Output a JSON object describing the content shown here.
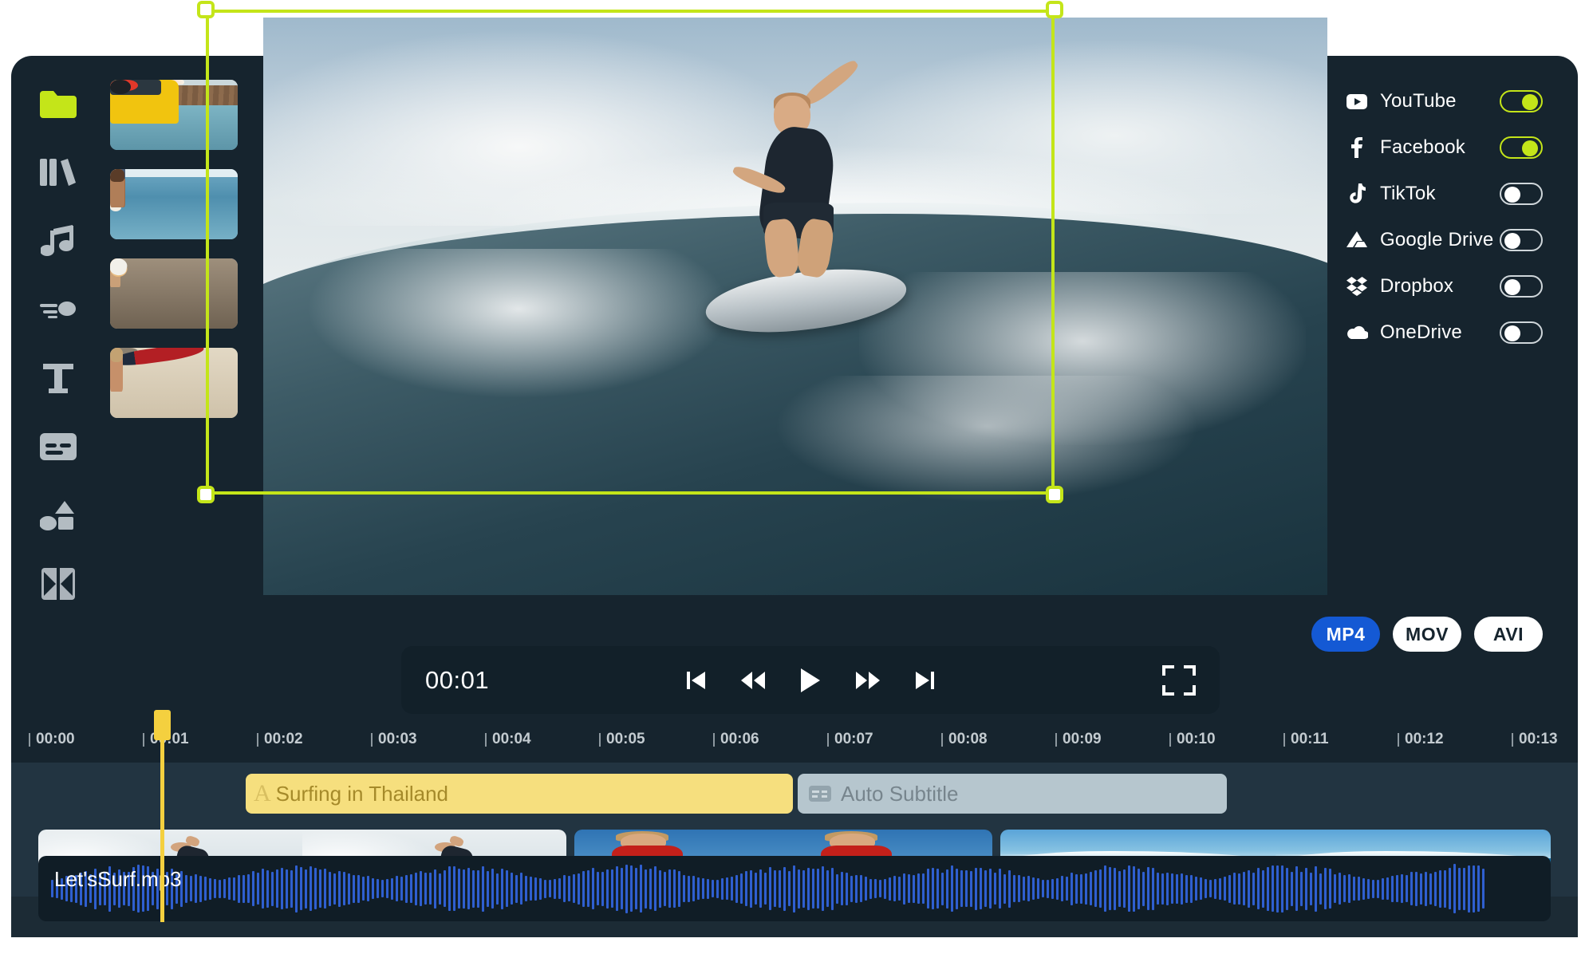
{
  "app": {
    "name": "video-editor"
  },
  "toolbar": {
    "items": [
      {
        "name": "media-folder",
        "icon": "folder-icon",
        "active": true
      },
      {
        "name": "library",
        "icon": "library-icon",
        "active": false
      },
      {
        "name": "audio",
        "icon": "music-note-icon",
        "active": false
      },
      {
        "name": "effects",
        "icon": "effects-icon",
        "active": false
      },
      {
        "name": "text",
        "icon": "text-icon",
        "active": false
      },
      {
        "name": "subtitles",
        "icon": "subtitle-icon",
        "active": false
      },
      {
        "name": "elements",
        "icon": "shapes-icon",
        "active": false
      },
      {
        "name": "transitions",
        "icon": "transition-icon",
        "active": false
      }
    ]
  },
  "media": {
    "thumbnails": [
      {
        "name": "jeep-on-pier"
      },
      {
        "name": "couple-with-surfboards"
      },
      {
        "name": "two-women-at-sunset"
      },
      {
        "name": "woman-with-red-surfboard"
      }
    ]
  },
  "preview": {
    "name": "surfer-on-wave"
  },
  "player": {
    "current_time": "00:01",
    "buttons": [
      {
        "name": "skip-to-start",
        "icon": "skip-start-icon"
      },
      {
        "name": "rewind",
        "icon": "rewind-icon"
      },
      {
        "name": "play",
        "icon": "play-icon"
      },
      {
        "name": "fast-forward",
        "icon": "fast-forward-icon"
      },
      {
        "name": "skip-to-end",
        "icon": "skip-end-icon"
      }
    ],
    "fullscreen_label": "fullscreen-icon"
  },
  "share": {
    "accent_on": "#c4e519",
    "destinations": [
      {
        "label": "YouTube",
        "icon": "youtube-icon",
        "enabled": true
      },
      {
        "label": "Facebook",
        "icon": "facebook-icon",
        "enabled": true
      },
      {
        "label": "TikTok",
        "icon": "tiktok-icon",
        "enabled": false
      },
      {
        "label": "Google Drive",
        "icon": "google-drive-icon",
        "enabled": false
      },
      {
        "label": "Dropbox",
        "icon": "dropbox-icon",
        "enabled": false
      },
      {
        "label": "OneDrive",
        "icon": "onedrive-icon",
        "enabled": false
      }
    ]
  },
  "formats": {
    "selected": "MP4",
    "selected_color": "#1459d4",
    "options": [
      "MP4",
      "MOV",
      "AVI"
    ]
  },
  "timeline": {
    "ruler_labels": [
      "00:00",
      "00:01",
      "00:02",
      "00:03",
      "00:04",
      "00:05",
      "00:06",
      "00:07",
      "00:08",
      "00:09",
      "00:10",
      "00:11",
      "00:12",
      "00:13"
    ],
    "playhead_time": "00:01",
    "playhead_color": "#f4d03f",
    "title_clip": {
      "label": "Surfing in Thailand",
      "icon": "text-a-icon",
      "color": "#f6df7e"
    },
    "subtitle_clip": {
      "label": "Auto Subtitle",
      "icon": "subtitle-icon",
      "color": "#b6c6ce"
    },
    "video_clips": [
      {
        "name": "clip-surfer-spray",
        "frames": 2
      },
      {
        "name": "clip-man-red-shirt",
        "frames": 2
      },
      {
        "name": "clip-blue-wave",
        "frames": 2
      }
    ],
    "audio_clip": {
      "label": "Let'sSurf.mp3",
      "waveform_color": "#2f5fd0"
    }
  }
}
